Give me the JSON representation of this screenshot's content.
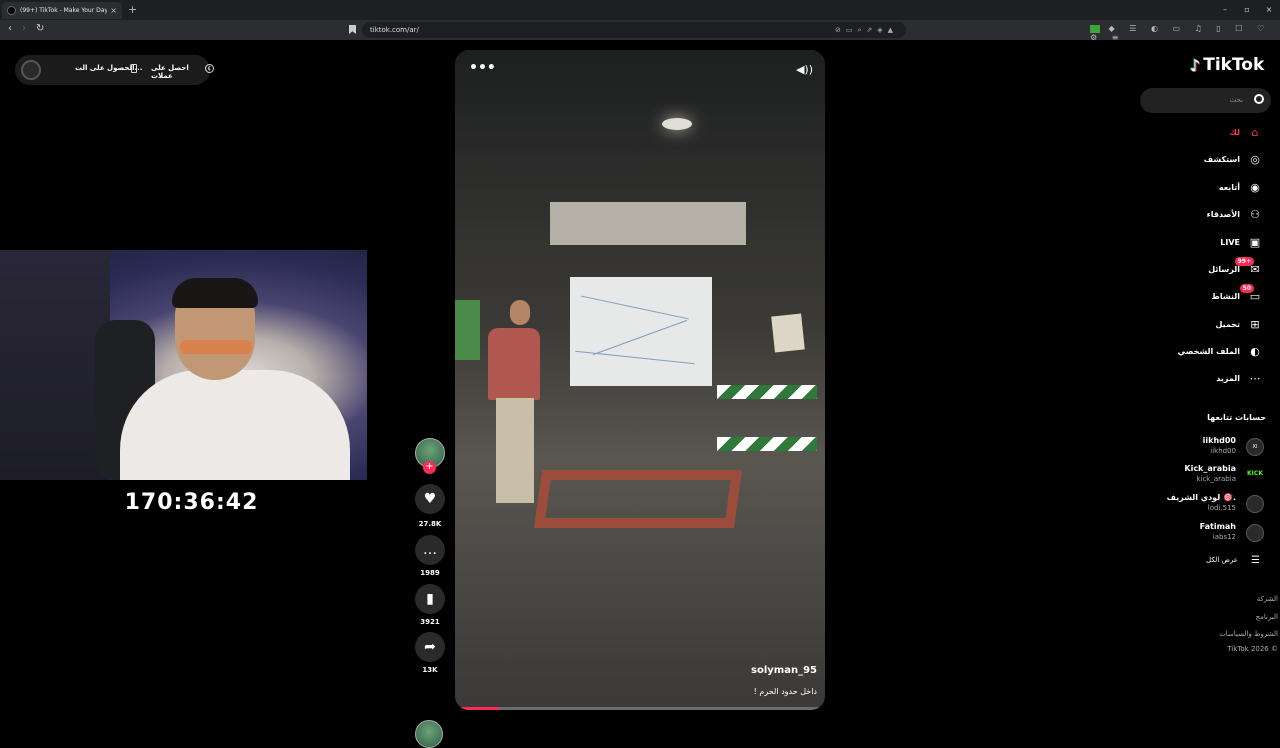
{
  "browser": {
    "tab_title": "(99+) TikTok - Make Your Day",
    "tab_close": "×",
    "new_tab": "+",
    "url": "tiktok.com/ar/",
    "window_controls": [
      "–",
      "▫",
      "×"
    ]
  },
  "promo": {
    "get_coins": "احصل على عملات",
    "get_app": "الحصول على الت..."
  },
  "stream": {
    "timer": "170:36:42"
  },
  "video": {
    "more_icon": "ellipsis-icon",
    "sound_icon": "speaker-icon",
    "username": "solyman_95",
    "caption": "داخل حدود الحرم !",
    "progress": 0.12
  },
  "actions": {
    "likes": "27.8K",
    "comments": "1989",
    "bookmarks": "3921",
    "shares": "13K"
  },
  "sidebar": {
    "logo": "TikTok",
    "search_placeholder": "بحث",
    "nav": [
      {
        "label": "لك",
        "icon": "home-icon",
        "glyph": "⌂",
        "active": true
      },
      {
        "label": "استكشف",
        "icon": "compass-icon",
        "glyph": "◎",
        "active": false
      },
      {
        "label": "أتابعه",
        "icon": "following-avatar-icon",
        "glyph": "◉",
        "active": false
      },
      {
        "label": "الأصدقاء",
        "icon": "friends-icon",
        "glyph": "⚇",
        "active": false
      },
      {
        "label": "LIVE",
        "icon": "live-icon",
        "glyph": "▣",
        "active": false
      },
      {
        "label": "الرسائل",
        "icon": "messages-icon",
        "glyph": "✉",
        "active": false,
        "badge": "99+"
      },
      {
        "label": "النشاط",
        "icon": "activity-icon",
        "glyph": "▭",
        "active": false,
        "badge": "50"
      },
      {
        "label": "تحميل",
        "icon": "upload-icon",
        "glyph": "⊞",
        "active": false
      },
      {
        "label": "الملف الشخصي",
        "icon": "profile-icon",
        "glyph": "◐",
        "active": false
      },
      {
        "label": "المزيد",
        "icon": "more-icon",
        "glyph": "⋯",
        "active": false
      }
    ],
    "following_title": "حسابات تتابعها",
    "following": [
      {
        "name": "iikhd00",
        "handle": "iikhd00",
        "avatar": "XI"
      },
      {
        "name": "Kick_arabia",
        "handle": "kick_arabia",
        "avatar": "KICK"
      },
      {
        "name": "لودي الشريف 🎯.",
        "handle": "lodi.515",
        "avatar": ""
      },
      {
        "name": "Fatimah",
        "handle": "iabs12",
        "avatar": ""
      }
    ],
    "see_all": "عرض الكل",
    "footer": [
      "الشركة",
      "البرنامج",
      "الشروط والسياسات",
      "© 2026 TikTok"
    ]
  },
  "colors": {
    "accent": "#fe2c55",
    "background": "#000000"
  }
}
